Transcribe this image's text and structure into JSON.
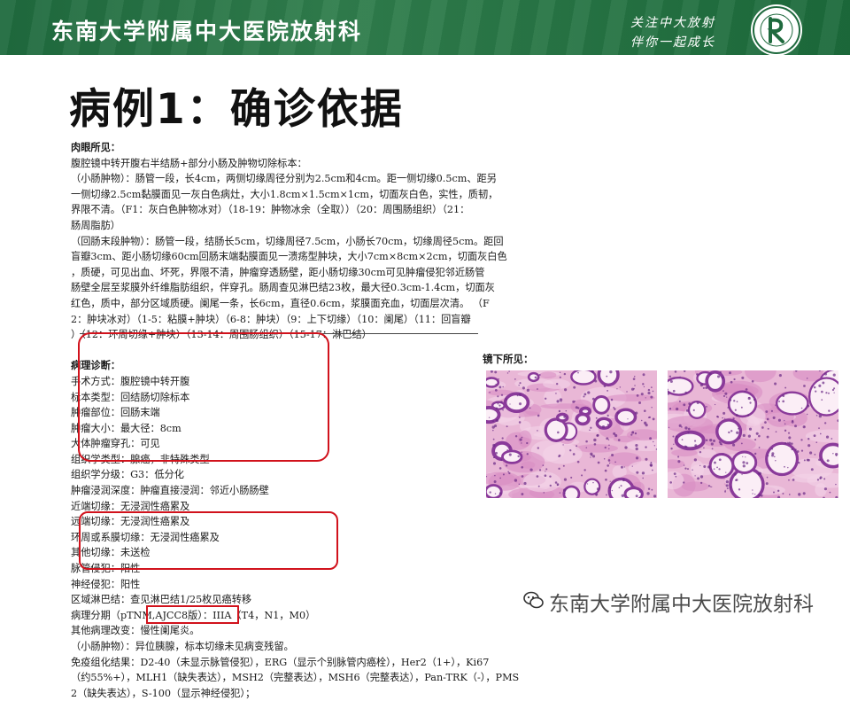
{
  "header": {
    "department": "东南大学附属中大医院放射科",
    "slogan_line1": "关注中大放射",
    "slogan_line2": "伴你一起成长",
    "logo_icon": "hospital-logo-icon",
    "bg_color": "#22703f"
  },
  "slide_title": "病例1：确诊依据",
  "report": {
    "lines": [
      "肉眼所见：",
      "    腹腔镜中转开腹右半结肠+部分小肠及肿物切除标本：",
      "    （小肠肿物）：肠管一段，长4cm，两侧切缘周径分别为2.5cm和4cm。距一侧切缘0.5cm、距另",
      "    一侧切缘2.5cm黏膜面见一灰白色病灶，大小1.8cm×1.5cm×1cm，切面灰白色，实性，质韧，",
      "    界限不清。（F1：灰白色肿物冰对）（18-19：肿物冰余（全取））（20：周围肠组织）（21：",
      "    肠周脂肪）",
      "    （回肠末段肿物）：肠管一段，结肠长5cm，切缘周径7.5cm，小肠长70cm，切缘周径5cm。距回",
      "    盲瓣3cm、距小肠切缘60cm回肠末端黏膜面见一溃疡型肿块，大小7cm×8cm×2cm，切面灰白色",
      "    ，质硬，可见出血、坏死，界限不清，肿瘤穿透肠壁，距小肠切缘30cm可见肿瘤侵犯邻近肠管",
      "    肠壁全层至浆膜外纤维脂肪组织，伴穿孔。肠周查见淋巴结23枚，最大径0.3cm-1.4cm，切面灰",
      "    红色，质中，部分区域质硬。阑尾一条，长6cm，直径0.6cm，浆膜面充血，切面层次清。  （F",
      "    2：肿块冰对）（1-5：粘膜+肿块）（6-8：肿块）（9：上下切缘）（10：阑尾）（11：回盲瓣",
      "    ）（12：环周切缘+肿块）（13-14：周围肠组织）（15-17：淋巴结）",
      "",
      "  病理诊断：",
      "    手术方式：腹腔镜中转开腹",
      "    标本类型：回结肠切除标本",
      "    肿瘤部位：回肠末端",
      "    肿瘤大小：最大径：8cm",
      "    大体肿瘤穿孔：可见",
      "  组织学类型：腺癌，非特殊类型",
      "  组织学分级：G3：低分化",
      "  肿瘤浸润深度：肿瘤直接浸润：邻近小肠肠壁",
      "  近端切缘：无浸润性癌累及",
      "  远端切缘：无浸润性癌累及",
      "  环周或系膜切缘：无浸润性癌累及",
      "  其他切缘：未送检",
      "  脉管侵犯：阳性",
      "  神经侵犯：阳性",
      "  区域淋巴结：查见淋巴结1/25枚见癌转移",
      "  病理分期（pTNM,AJCC8版）：IIIA（T4，N1，M0）",
      "  其他病理改变：慢性阑尾炎。",
      "  （小肠肿物）：异位胰腺，标本切缘未见病变残留。",
      "  免疫组化结果：D2-40（未显示脉管侵犯），ERG（显示个别脉管内癌栓），Her2（1+），Ki67",
      "  （约55%+），MLH1（缺失表达），MSH2（完整表达），MSH6（完整表达），Pan-TRK（-），PMS",
      "  2（缺失表达），S-100（显示神经侵犯）；"
    ]
  },
  "micro": {
    "label": "镜下所见："
  },
  "highlight_color": "#d1121c",
  "watermark": {
    "text": "东南大学附属中大医院放射科",
    "icon": "wechat-icon"
  }
}
